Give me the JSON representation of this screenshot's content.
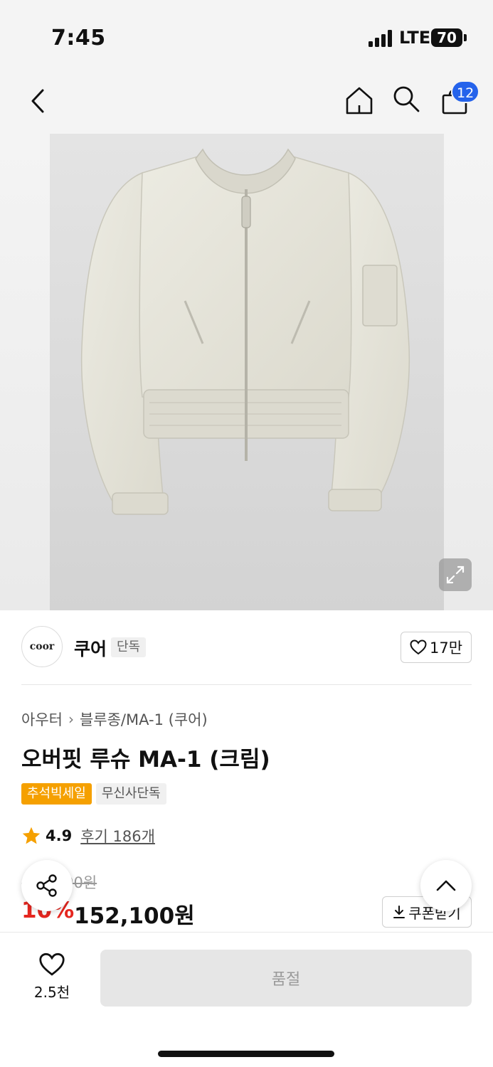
{
  "status_bar": {
    "time": "7:45",
    "network": "LTE",
    "battery": "70"
  },
  "nav": {
    "cart_count": "12"
  },
  "brand": {
    "logo_text": "coor",
    "name": "쿠어",
    "tag": "단독",
    "likes": "17만"
  },
  "product": {
    "breadcrumb": [
      "아우터",
      "블루종/MA-1 (쿠어)"
    ],
    "title": "오버핏 루슈 MA-1 (크림)",
    "badges": [
      "추석빅세일",
      "무신사단독"
    ],
    "rating": "4.9",
    "reviews": "후기 186개",
    "original_price": "169,000원",
    "discount": "10%",
    "price": "152,100원",
    "coupon_label": "쿠폰받기"
  },
  "bottom": {
    "wish_count": "2.5천",
    "buy_label": "품절"
  }
}
